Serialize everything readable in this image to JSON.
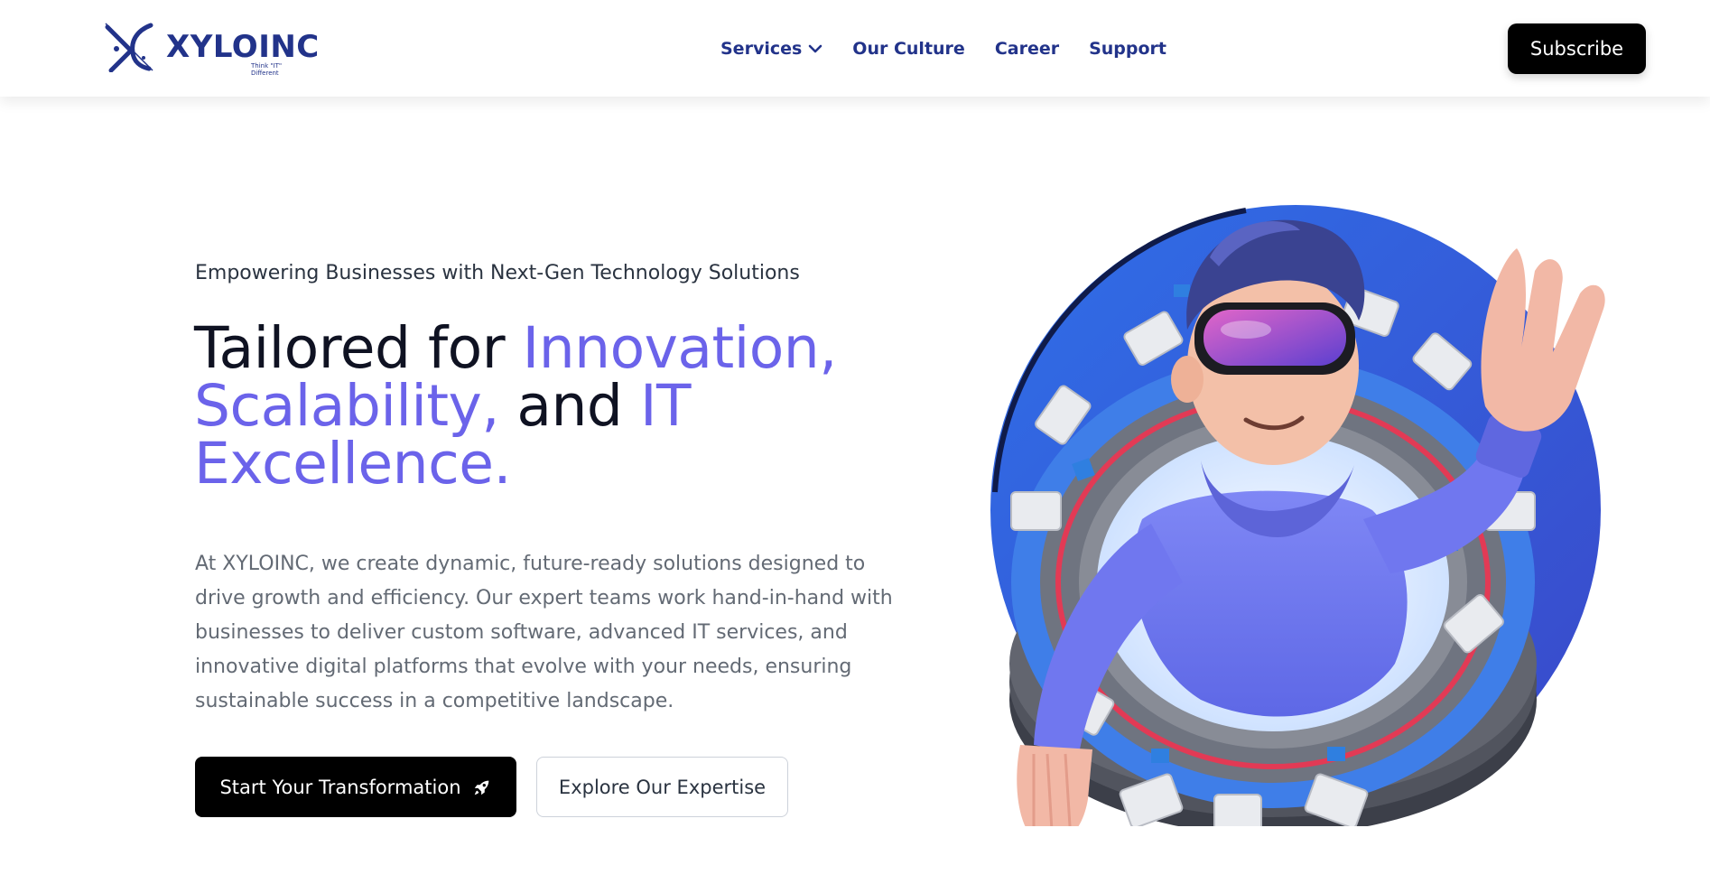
{
  "brand": {
    "name": "XYLOINC",
    "tagline": "Think \"IT\" Different",
    "colors": {
      "navy": "#22338a",
      "accent": "#6b63ea",
      "black": "#000000",
      "circle": "#3f5be0"
    }
  },
  "nav": {
    "items": [
      {
        "label": "Services",
        "has_dropdown": true
      },
      {
        "label": "Our Culture"
      },
      {
        "label": "Career"
      },
      {
        "label": "Support"
      }
    ],
    "subscribe_label": "Subscribe"
  },
  "hero": {
    "eyebrow": "Empowering Businesses with Next-Gen Technology Solutions",
    "headline": {
      "part1": "Tailored for ",
      "accent1": "Innovation,",
      "accent2": "Scalability,",
      "part2": " and ",
      "accent3": "IT",
      "accent4": "Excellence."
    },
    "description": "At XYLOINC, we create dynamic, future-ready solutions designed to drive growth and efficiency. Our expert teams work hand-in-hand with businesses to deliver custom software, advanced IT services, and innovative digital platforms that evolve with your needs, ensuring sustainable success in a competitive landscape.",
    "primary_cta": {
      "label": "Start Your Transformation",
      "icon": "rocket-icon"
    },
    "secondary_cta": {
      "label": "Explore Our Expertise"
    }
  }
}
